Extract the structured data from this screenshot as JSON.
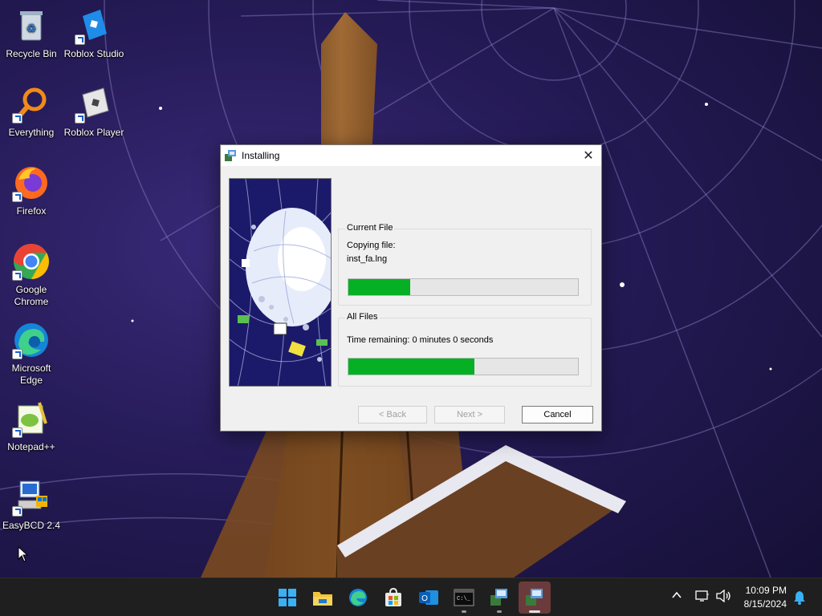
{
  "desktop": {
    "icons": [
      {
        "label": "Recycle Bin"
      },
      {
        "label": "Roblox Studio"
      },
      {
        "label": "Everything"
      },
      {
        "label": "Roblox Player"
      },
      {
        "label": "Firefox"
      },
      {
        "label": "Google Chrome"
      },
      {
        "label": "Microsoft Edge"
      },
      {
        "label": "Notepad++"
      },
      {
        "label": "EasyBCD 2.4"
      }
    ]
  },
  "dialog": {
    "title": "Installing",
    "close_icon": "close-icon",
    "current_file": {
      "group_label": "Current File",
      "status_line": "Copying file:",
      "file_name": "inst_fa.lng",
      "progress": 0.27
    },
    "all_files": {
      "group_label": "All Files",
      "time_remaining": "Time remaining: 0 minutes 0 seconds",
      "progress": 0.55
    },
    "buttons": {
      "back": "< Back",
      "next": "Next >",
      "cancel": "Cancel"
    }
  },
  "taskbar": {
    "items": [
      "start-icon",
      "file-explorer-icon",
      "edge-icon",
      "store-icon",
      "outlook-icon",
      "terminal-icon",
      "installer-icon",
      "installer-active-icon"
    ],
    "accent": "#06b025",
    "clock": {
      "time": "10:09 PM",
      "date": "8/15/2024"
    }
  }
}
